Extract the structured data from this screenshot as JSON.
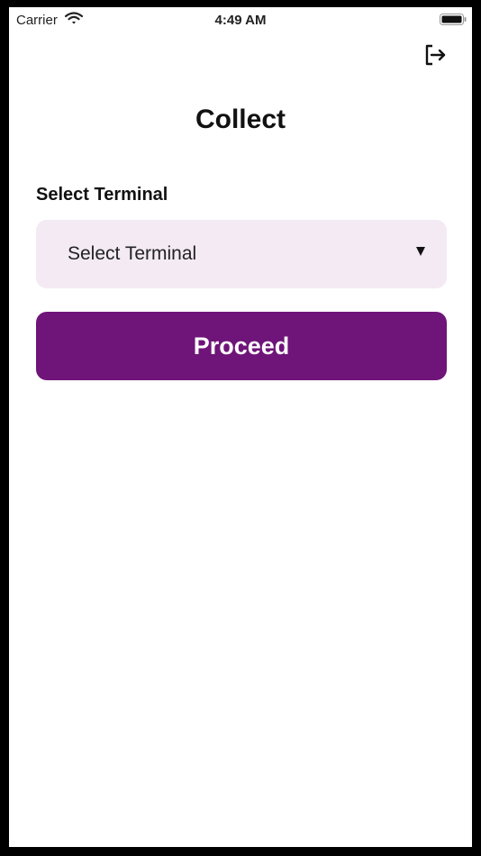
{
  "status_bar": {
    "carrier": "Carrier",
    "time": "4:49 AM",
    "wifi_icon": "wifi-icon",
    "battery_icon": "battery-icon"
  },
  "header": {
    "logout_icon": "logout-icon",
    "title": "Collect"
  },
  "form": {
    "terminal_label": "Select Terminal",
    "terminal_select": {
      "selected_value": "Select Terminal",
      "arrow_icon": "caret-down-icon"
    },
    "proceed_label": "Proceed"
  },
  "colors": {
    "accent": "#6f1479",
    "select_background": "#f3eaf4",
    "background": "#ffffff",
    "frame": "#000000"
  }
}
